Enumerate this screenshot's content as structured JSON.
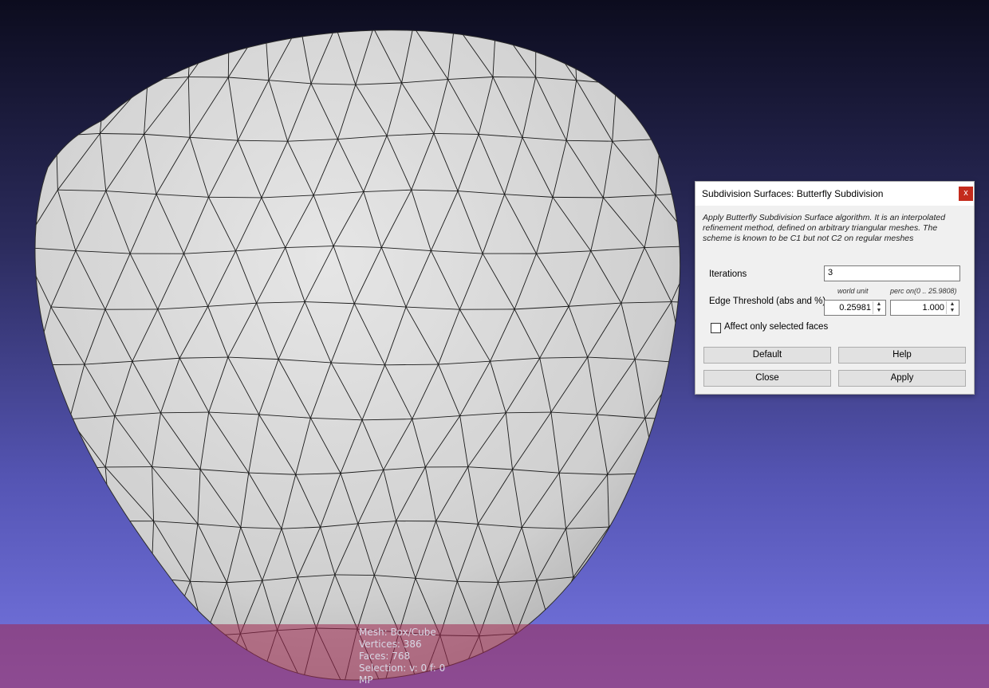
{
  "viewport": {
    "mesh_fill": "#d9d9d9",
    "wire_color": "#1a1a1a"
  },
  "info": {
    "mesh": "Mesh: Box/Cube",
    "vertices": "Vertices: 386",
    "faces": "Faces: 768",
    "selection": "Selection: v: 0 f: 0",
    "mode": "MP"
  },
  "dialog": {
    "title": "Subdivision Surfaces: Butterfly Subdivision",
    "close_glyph": "x",
    "description": "Apply Butterfly Subdivision Surface algorithm. It is an interpolated refinement method, defined on arbitrary triangular meshes. The scheme is known to be C1 but not C2 on regular meshes",
    "iterations_label": "Iterations",
    "iterations_value": "3",
    "world_unit_label": "world unit",
    "perc_label": "perc on(0 .. 25.9808)",
    "edge_threshold_label": "Edge Threshold (abs and %)",
    "edge_abs_value": "0.25981",
    "edge_perc_value": "1.000",
    "affect_selected_label": "Affect only selected faces",
    "affect_selected_checked": false,
    "default_label": "Default",
    "help_label": "Help",
    "close_label": "Close",
    "apply_label": "Apply",
    "close_color": "#c42b1c"
  }
}
